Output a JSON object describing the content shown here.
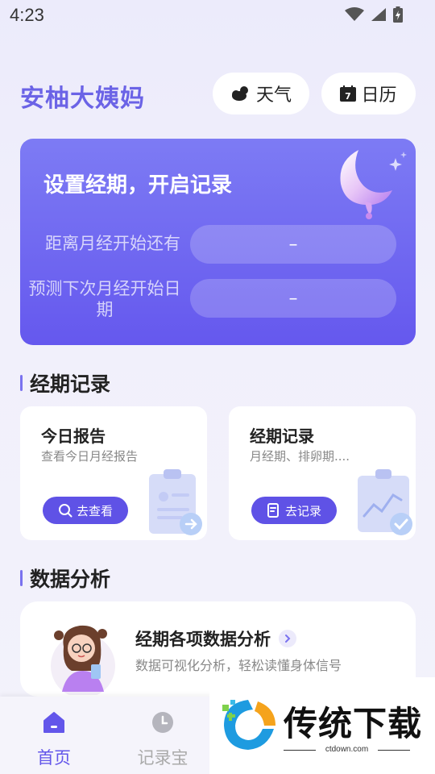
{
  "status_bar": {
    "time": "4:23"
  },
  "header": {
    "app_title": "安柚大姨妈",
    "weather_label": "天气",
    "calendar_label": "日历",
    "calendar_day": "7"
  },
  "hero": {
    "title": "设置经期，开启记录",
    "countdown_label": "距离月经开始还有",
    "countdown_value": "–",
    "prediction_label": "预测下次月经开始日期",
    "prediction_value": "–"
  },
  "records_section": {
    "title": "经期记录",
    "cards": [
      {
        "title": "今日报告",
        "subtitle": "查看今日月经报告",
        "button": "去查看"
      },
      {
        "title": "经期记录",
        "subtitle": "月经期、排卵期....",
        "button": "去记录"
      }
    ]
  },
  "analysis_section": {
    "title": "数据分析",
    "card_title": "经期各项数据分析",
    "card_subtitle": "数据可视化分析，轻松读懂身体信号"
  },
  "tabbar": {
    "items": [
      {
        "label": "首页"
      },
      {
        "label": "记录宝"
      }
    ]
  },
  "watermark": {
    "text": "传统下载",
    "url": "ctdown.com"
  },
  "colors": {
    "accent": "#6356ea",
    "hero_top": "#7d7bf4",
    "hero_bottom": "#6558ee"
  }
}
